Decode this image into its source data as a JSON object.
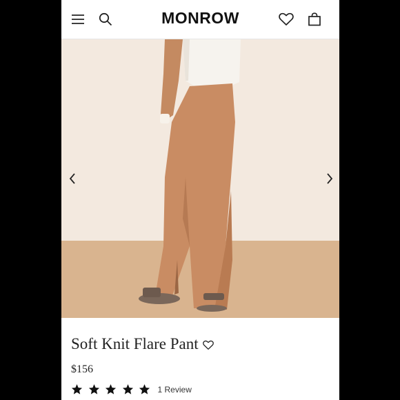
{
  "header": {
    "logo": "MONROW",
    "icons": [
      "hamburger-menu-icon",
      "search-icon",
      "heart-icon",
      "shopping-bag-icon"
    ]
  },
  "gallery": {
    "prev_icon": "chevron-left-icon",
    "next_icon": "chevron-right-icon"
  },
  "product": {
    "title": "Soft Knit Flare Pant",
    "price": "$156",
    "rating": 5,
    "rating_max": 5,
    "review_text": "1 Review"
  },
  "colors": {
    "background": "#ffffff",
    "text": "#222222",
    "pant": "#c98c63",
    "wall": "#f3e9df",
    "floor": "#d9b48f"
  }
}
